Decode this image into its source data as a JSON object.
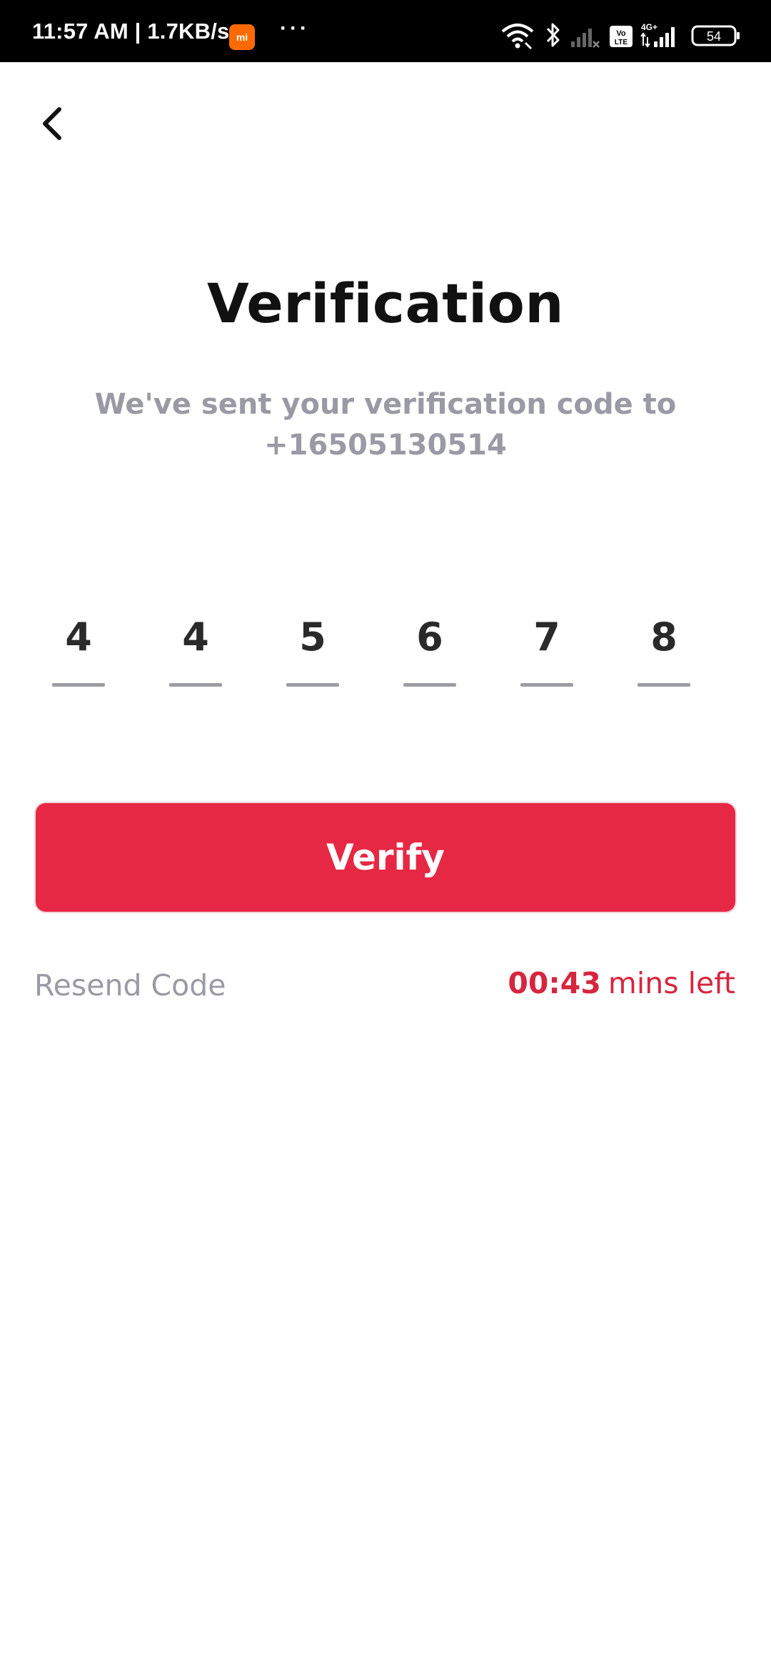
{
  "status_bar": {
    "time": "11:57 AM | 1.7KB/s",
    "mi_badge": "mi",
    "dots": "···",
    "battery": "54",
    "network": "4G+",
    "volte": "Vo LTE"
  },
  "header": {
    "back_icon": "chevron-left-icon"
  },
  "main": {
    "title": "Verification",
    "subtitle_line1": "We've sent your verification code to",
    "subtitle_line2": "+16505130514",
    "otp_digits": [
      "4",
      "4",
      "5",
      "6",
      "7",
      "8"
    ],
    "verify_label": "Verify",
    "resend_label": "Resend Code",
    "timer_value": "00:43",
    "timer_suffix": "mins left"
  },
  "colors": {
    "accent": "#e62845",
    "muted_text": "#9a9aa4",
    "timer": "#d6263f"
  }
}
